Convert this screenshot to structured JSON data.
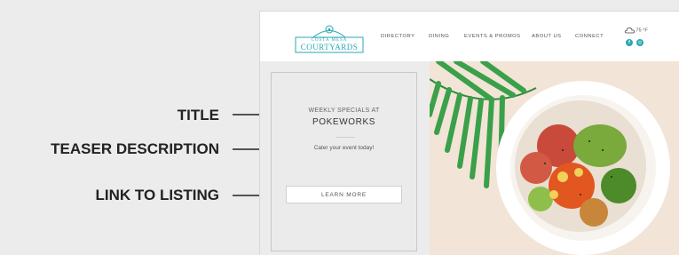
{
  "annotations": {
    "title": "TITLE",
    "teaser_description": "TEASER DESCRIPTION",
    "link_to_listing": "LINK TO LISTING"
  },
  "site": {
    "logo": {
      "line1": "COSTA MESA",
      "line2": "COURTYARDS"
    },
    "nav": [
      "DIRECTORY",
      "DINING",
      "EVENTS & PROMOS",
      "ABOUT US",
      "CONNECT"
    ],
    "weather": {
      "temp": "75 °F",
      "icon": "cloud-icon"
    },
    "social": [
      {
        "name": "facebook-icon",
        "glyph": "f"
      },
      {
        "name": "instagram-icon",
        "glyph": "◎"
      }
    ],
    "brand_color": "#2aa8b4"
  },
  "teaser": {
    "kicker": "WEEKLY SPECIALS AT",
    "title": "POKEWORKS",
    "description": "Cater your event today!",
    "button_label": "LEARN MORE"
  }
}
